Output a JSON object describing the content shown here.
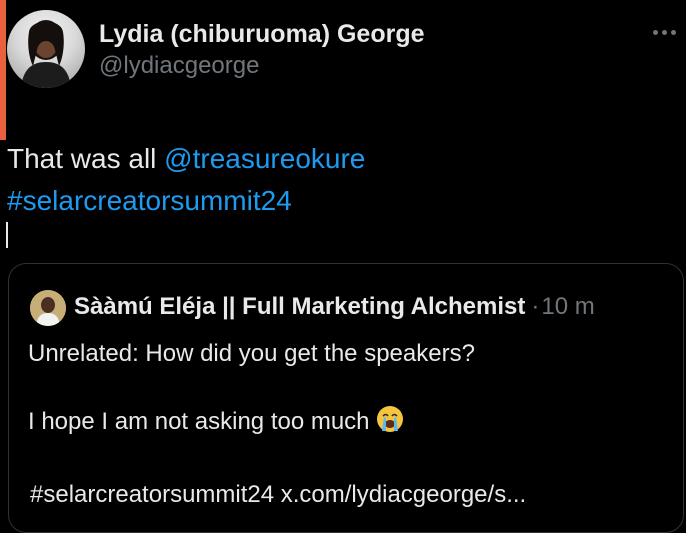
{
  "tweet": {
    "author": {
      "display_name": "Lydia (chiburuoma) George",
      "handle": "@lydiacgeorge"
    },
    "more_icon": "more-horizontal-icon",
    "text_prefix": "That was all ",
    "mention": "@treasureokure",
    "hashtag": "#selarcreatorsummit24"
  },
  "quote": {
    "author_name": "Sààmú Eléja || Full Marketing Alchemist",
    "separator": "·",
    "time": "10 m",
    "line1": "Unrelated: How did you get the speakers?",
    "line2": "I hope I am not asking too much",
    "line2_emoji": "loudly-crying-face-emoji",
    "line3": "#selarcreatorsummit24 x.com/lydiacgeorge/s..."
  },
  "colors": {
    "background": "#000000",
    "text": "#e7e9ea",
    "secondary": "#71767b",
    "link": "#1d9bf0",
    "border": "#2f3336",
    "edge_accent": "#e8603c"
  }
}
